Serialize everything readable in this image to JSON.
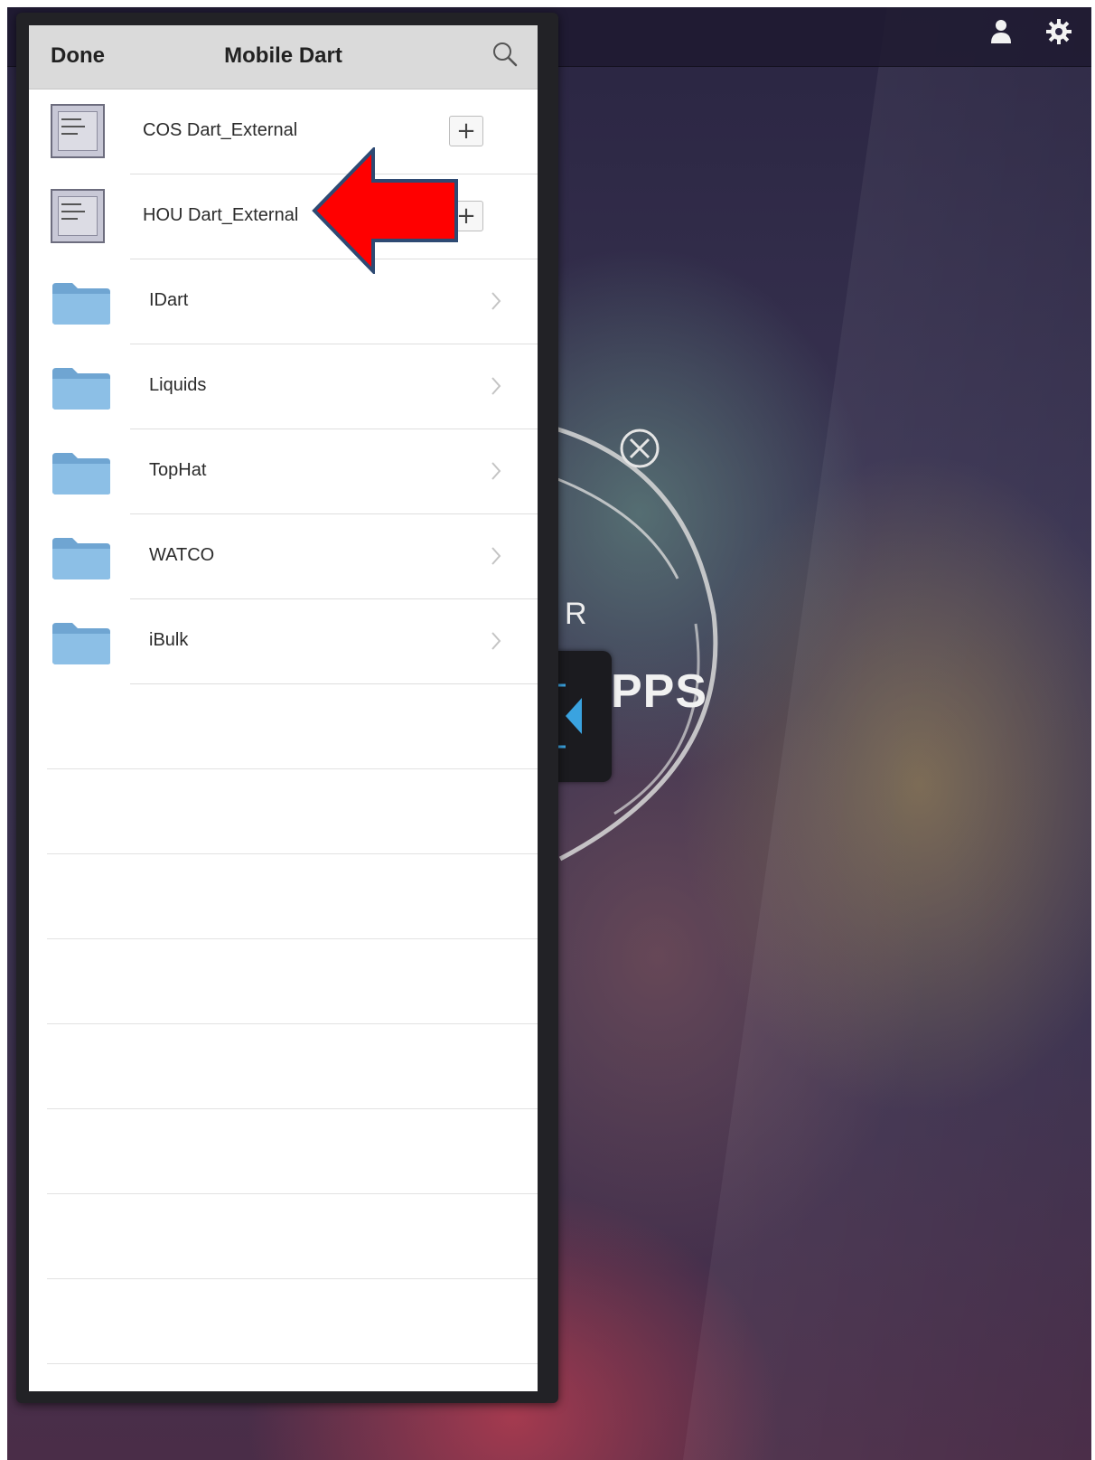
{
  "background_app": {
    "brand_partial_top": "R",
    "brand_partial": "PPS"
  },
  "navbar": {
    "done_label": "Done",
    "title": "Mobile Dart"
  },
  "list": {
    "items": [
      {
        "label": "COS Dart_External",
        "type": "app",
        "action": "+"
      },
      {
        "label": "HOU Dart_External",
        "type": "app",
        "action": "+"
      },
      {
        "label": "IDart",
        "type": "folder"
      },
      {
        "label": "Liquids",
        "type": "folder"
      },
      {
        "label": "TopHat",
        "type": "folder"
      },
      {
        "label": "WATCO",
        "type": "folder"
      },
      {
        "label": "iBulk",
        "type": "folder"
      }
    ]
  },
  "annotation": {
    "arrow_color": "#ff0000",
    "arrow_border": "#2e4a73",
    "points_to": "HOU Dart_External"
  },
  "colors": {
    "navbar_bg": "#dadada",
    "folder_blue": "#7fb3dc",
    "dock_accent": "#3aa3e0"
  }
}
